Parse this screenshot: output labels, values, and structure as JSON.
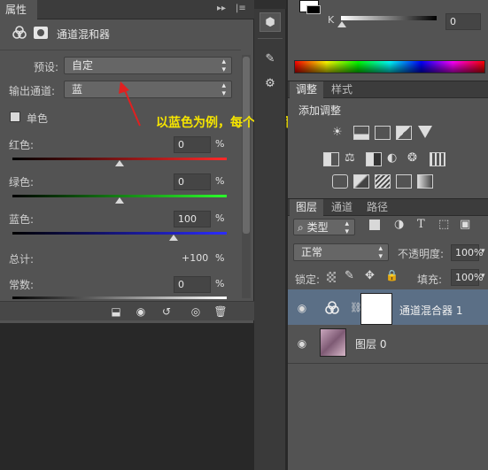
{
  "properties": {
    "tab_label": "属性",
    "panel_title": "通道混和器",
    "preset_label": "预设:",
    "preset_value": "自定",
    "output_label": "输出通道:",
    "output_value": "蓝",
    "mono_label": "单色",
    "red_label": "红色:",
    "red_value": "0",
    "green_label": "绿色:",
    "green_value": "0",
    "blue_label": "蓝色:",
    "blue_value": "100",
    "total_label": "总计:",
    "total_value": "+100",
    "constant_label": "常数:",
    "constant_value": "0",
    "pct": "%",
    "mono_checked": false,
    "red_level": 0,
    "green_level": 0,
    "blue_level": 100
  },
  "annotation": {
    "text": "以蓝色为例，每个通道都调成这样子",
    "color": "#f5e400"
  },
  "color_panel": {
    "k_label": "K",
    "k_value": "0"
  },
  "adjust_panel": {
    "tab_adjust": "调整",
    "tab_style": "样式",
    "add_adjust": "添加调整"
  },
  "layers_panel": {
    "tab_layers": "图层",
    "tab_channels": "通道",
    "tab_paths": "路径",
    "filter_kind": "类型",
    "blend_mode": "正常",
    "opacity_label": "不透明度:",
    "opacity_value": "100%",
    "lock_label": "锁定:",
    "fill_label": "填充:",
    "fill_value": "100%",
    "layers": [
      {
        "name": "通道混合器 1",
        "selected": true
      },
      {
        "name": "图层 0",
        "selected": false
      }
    ]
  }
}
